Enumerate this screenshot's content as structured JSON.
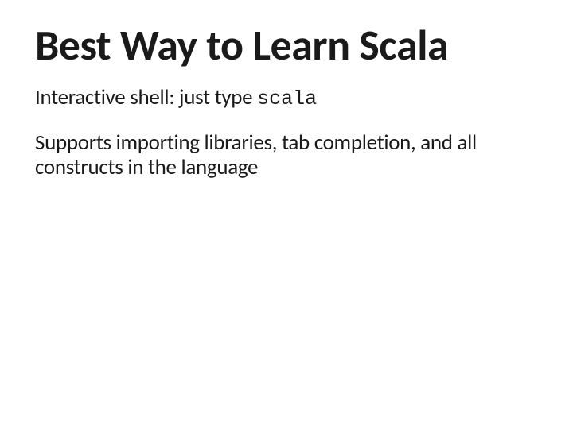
{
  "slide": {
    "title": "Best Way to Learn Scala",
    "line1_prefix": "Interactive shell: just type ",
    "line1_code": "scala",
    "line2": "Supports importing libraries, tab completion, and all constructs in the language"
  }
}
